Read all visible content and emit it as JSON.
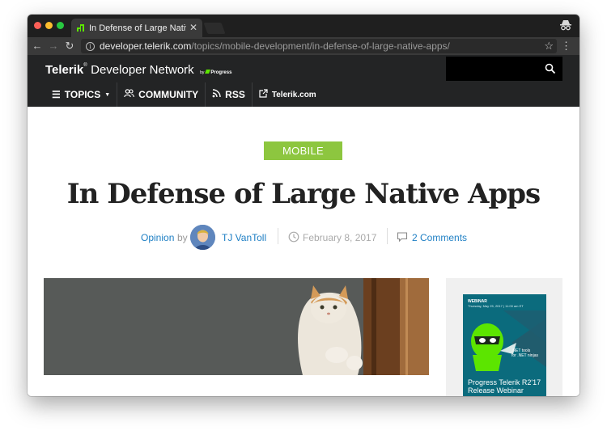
{
  "browser": {
    "tab_title": "In Defense of Large Native Apps",
    "url_host": "developer.telerik.com",
    "url_path": "/topics/mobile-development/in-defense-of-large-native-apps/",
    "icons": [
      "back-arrow-icon",
      "forward-arrow-icon",
      "reload-icon",
      "info-icon",
      "star-icon",
      "menu-icon",
      "incognito-icon",
      "close-icon"
    ]
  },
  "site": {
    "brand_telerik": "Telerik",
    "brand_tm": "®",
    "brand_dn": "Developer Network",
    "brand_by": "by",
    "brand_progress": "Progress",
    "nav": {
      "topics": "TOPICS",
      "community": "COMMUNITY",
      "rss": "RSS",
      "telerik": "Telerik.com"
    },
    "colors": {
      "header_bg": "#232425",
      "accent_green": "#8dc63f",
      "link_blue": "#1e7fc4"
    }
  },
  "article": {
    "category": "MOBILE",
    "title": "In Defense of Large Native Apps",
    "byline": {
      "category": "Opinion",
      "by": "by",
      "author": "TJ VanToll",
      "date": "February 8, 2017",
      "comments": "2 Comments"
    }
  },
  "ad": {
    "label": "WEBINAR",
    "date": "Thursday, May 25, 2017 | 11:00 am ET",
    "net_line1": ".NET tools",
    "net_line2": "for .NET ninjas",
    "title": "Progress Telerik R2'17 Release Webinar"
  }
}
